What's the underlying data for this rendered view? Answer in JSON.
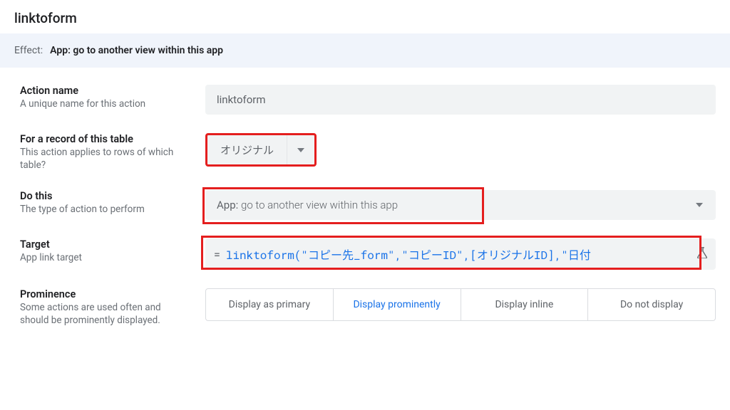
{
  "page_title": "linktoform",
  "effect": {
    "label": "Effect:",
    "value": "App: go to another view within this app"
  },
  "fields": {
    "action_name": {
      "label": "Action name",
      "desc": "A unique name for this action",
      "value": "linktoform"
    },
    "record_table": {
      "label": "For a record of this table",
      "desc": "This action applies to rows of which table?",
      "value": "オリジナル"
    },
    "do_this": {
      "label": "Do this",
      "desc": "The type of action to perform",
      "prefix": "App:",
      "value": "go to another view within this app"
    },
    "target": {
      "label": "Target",
      "desc": "App link target",
      "expr": "linktoform(\"コピー先_form\",\"コピーID\",[オリジナルID],\"日付"
    },
    "prominence": {
      "label": "Prominence",
      "desc": "Some actions are used often and should be prominently displayed.",
      "options": [
        "Display as primary",
        "Display prominently",
        "Display inline",
        "Do not display"
      ],
      "selected": 1
    }
  }
}
